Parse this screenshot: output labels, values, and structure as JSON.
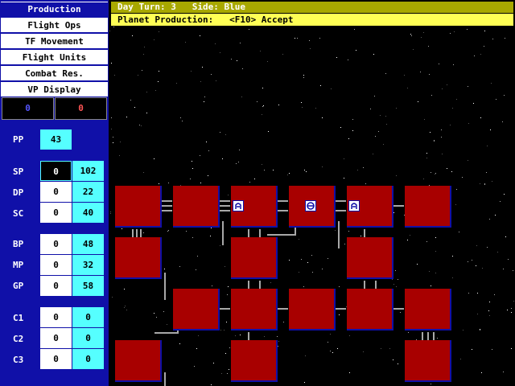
{
  "menu": {
    "items": [
      {
        "label": "Production",
        "active": true
      },
      {
        "label": "Flight Ops",
        "active": false
      },
      {
        "label": "TF Movement",
        "active": false
      },
      {
        "label": "Flight Units",
        "active": false
      },
      {
        "label": "Combat Res.",
        "active": false
      },
      {
        "label": "VP Display",
        "active": false
      }
    ]
  },
  "vp": {
    "blue": "0",
    "red": "0",
    "blue_color": "#5555ff",
    "red_color": "#ff5555"
  },
  "stats": {
    "pp": {
      "label": "PP",
      "value": "43"
    },
    "sp": {
      "label": "SP",
      "a": "0",
      "b": "102"
    },
    "dp": {
      "label": "DP",
      "a": "0",
      "b": "22"
    },
    "sc": {
      "label": "SC",
      "a": "0",
      "b": "40"
    },
    "bp": {
      "label": "BP",
      "a": "0",
      "b": "48"
    },
    "mp": {
      "label": "MP",
      "a": "0",
      "b": "32"
    },
    "gp": {
      "label": "GP",
      "a": "0",
      "b": "58"
    },
    "c1": {
      "label": "C1",
      "a": "0",
      "b": "0"
    },
    "c2": {
      "label": "C2",
      "a": "0",
      "b": "0"
    },
    "c3": {
      "label": "C3",
      "a": "0",
      "b": "0"
    }
  },
  "status": {
    "line1": "Day Turn: 3   Side: Blue",
    "line2": "Planet Production:   <F10> Accept"
  },
  "map": {
    "planet_color": "#a80000",
    "unit_icons": [
      "fleet-unit-icon",
      "ship-unit-icon",
      "fleet-unit-icon"
    ]
  }
}
